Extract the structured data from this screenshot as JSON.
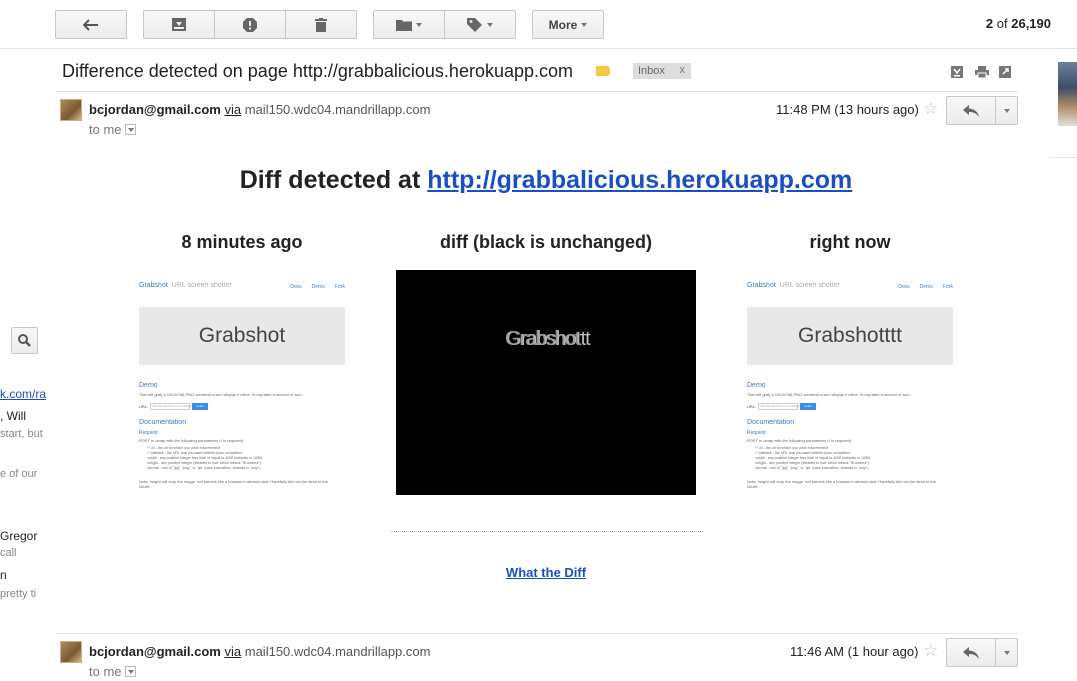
{
  "toolbar": {
    "back_icon": "back-arrow-icon",
    "archive_icon": "archive-icon",
    "spam_icon": "report-spam-icon",
    "delete_icon": "trash-icon",
    "move_icon": "folder-icon",
    "labels_icon": "tag-icon",
    "more_label": "More"
  },
  "pager": {
    "current": "2",
    "of_word": "of",
    "total": "26,190"
  },
  "subject": {
    "text": "Difference detected on page http://grabbalicious.herokuapp.com",
    "label_color": "#f6c744",
    "inbox_label": "Inbox",
    "inbox_remove": "x"
  },
  "messages": [
    {
      "sender": "bcjordan@gmail.com",
      "via": "via",
      "via_domain": "mail150.wdc04.mandrillapp.com",
      "to": "to me",
      "time": "11:48 PM (13 hours ago)"
    },
    {
      "sender": "bcjordan@gmail.com",
      "via": "via",
      "via_domain": "mail150.wdc04.mandrillapp.com",
      "to": "to me",
      "time": "11:46 AM (1 hour ago)"
    }
  ],
  "body": {
    "title_prefix": "Diff detected at",
    "title_link": "http://grabbalicious.herokuapp.com",
    "col_before": "8 minutes ago",
    "col_diff": "diff (black is unchanged)",
    "col_after": "right now",
    "what_the_diff": "What the Diff"
  },
  "screenshots": {
    "brand": "Grabshot",
    "brand_tagline": "URL screen shotter",
    "nav_docs": "Docs",
    "nav_demo": "Demo",
    "nav_fork": "Fork",
    "hero_before": "Grabshot",
    "hero_after": "Grabshotttt",
    "demo_heading": "Demo",
    "demo_text": "This will grab a 1024x768 PNG screenshot and display it inline. It may take a second or two...",
    "url_label": "URL:",
    "url_placeholder": "http://grabbalicious.herokuapp.com",
    "grab_button": "Grab!",
    "doc_heading": "Documentation",
    "request_heading": "Request",
    "params_text": "POST to /snap with the following parameters (* is required):",
    "bullets": [
      "* url - the url for which you want a screenshot.",
      "* callback - the URL that you want notified upon completion.",
      "width - any positive integer less than or equal to 4000 (defaults to 1280).",
      "height - any positive integer (defaults to null, which means \"fit content\").",
      "format - one of \"jpg\", \"png\", or \"gif\" (case insensitive, defaults to \"png\")."
    ],
    "note": "Note: height will crop the image, not behave like a browser's window size. Hopefully this can be fixed in the future.",
    "diff_ghost_a": "Grabshottt",
    "diff_ghost_b": "Grabshot"
  },
  "left_sidebar": {
    "link_fragment": "k.com/ra",
    "name_fragment": ", Will",
    "snippet_1": "start, but",
    "snippet_2": "e of our",
    "name_2": "Gregor",
    "snippet_3": "call",
    "name_3": "n",
    "snippet_4": "pretty ti"
  }
}
